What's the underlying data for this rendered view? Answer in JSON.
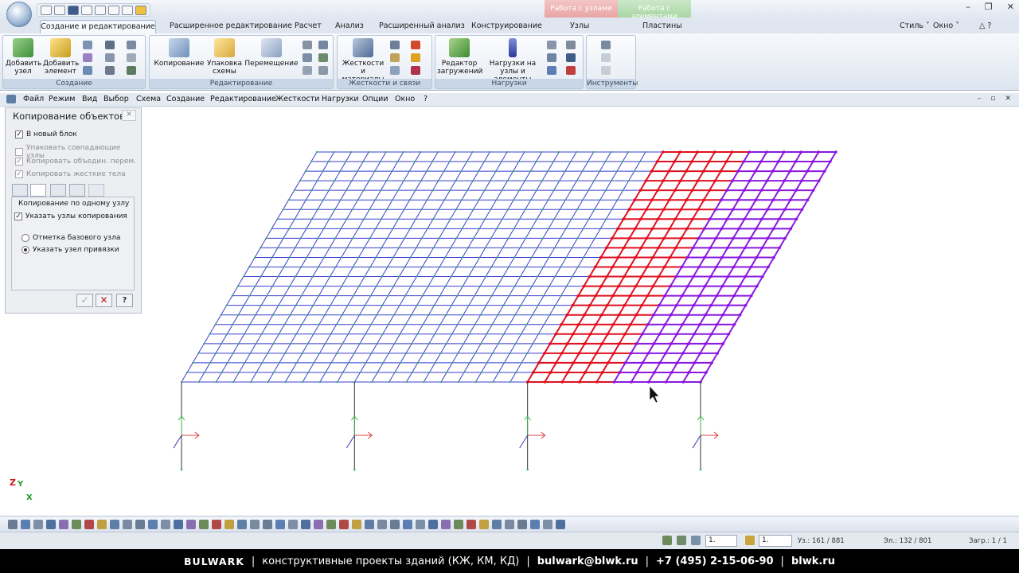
{
  "ribbon_tabs": {
    "active": "Создание и редактирование",
    "items": [
      "Расширенное редактирование",
      "Расчет",
      "Анализ",
      "Расширенный анализ",
      "Конструирование",
      "Узлы",
      "Пластины"
    ],
    "right": [
      "Стиль",
      "Окно"
    ]
  },
  "context_tabs": [
    "Работа с узлами",
    "Работа с элементами"
  ],
  "ribbon": {
    "groups": [
      {
        "caption": "Создание",
        "buttons": [
          "Добавить узел",
          "Добавить элемент"
        ]
      },
      {
        "caption": "Редактирование",
        "buttons": [
          "Копирование",
          "Упаковка схемы",
          "Перемещение"
        ]
      },
      {
        "caption": "Жесткости и связи",
        "buttons": [
          "Жесткости и материалы"
        ]
      },
      {
        "caption": "Нагрузки",
        "buttons": [
          "Редактор загружений",
          "Нагрузки на узлы и элементы"
        ]
      },
      {
        "caption": "Инструменты",
        "buttons": []
      }
    ]
  },
  "menu": [
    "Файл",
    "Режим",
    "Вид",
    "Выбор",
    "Схема",
    "Создание",
    "Редактирование",
    "Жесткости",
    "Нагрузки",
    "Опции",
    "Окно",
    "?"
  ],
  "panel": {
    "title": "Копирование объектов",
    "checks": [
      {
        "label": "В новый блок",
        "checked": true,
        "enabled": true
      },
      {
        "label": "Упаковать совпадающие узлы",
        "checked": false,
        "enabled": false
      },
      {
        "label": "Копировать объедин. перем.",
        "checked": true,
        "enabled": false
      },
      {
        "label": "Копировать жесткие тела",
        "checked": true,
        "enabled": false
      }
    ],
    "mode_title": "Копирование по одному узлу",
    "specify_nodes": "Указать узлы копирования",
    "radios": [
      {
        "label": "Отметка базового узла",
        "selected": false
      },
      {
        "label": "Указать узел привязки",
        "selected": true
      }
    ]
  },
  "model": {
    "grid_cols": 30,
    "grid_rows": 24,
    "red_from_col": 20,
    "red_to_col": 25,
    "colors": {
      "blue": "#3a3ad6",
      "red": "#e01020",
      "purple": "#8a18e0",
      "green": "#2bb54a"
    },
    "axis": [
      "Z",
      "Y",
      "X"
    ]
  },
  "status": {
    "field1": "1.",
    "field2": "1.",
    "nodes": "Уз.: 161 / 881",
    "elements": "Эл.: 132 / 801",
    "load": "Загр.: 1 / 1"
  },
  "footer": {
    "brand": "BULWARK",
    "text": "конструктивные проекты зданий (КЖ, КМ, КД)",
    "email": "bulwark@blwk.ru",
    "phone": "+7 (495) 2-15-06-90",
    "site": "blwk.ru"
  }
}
